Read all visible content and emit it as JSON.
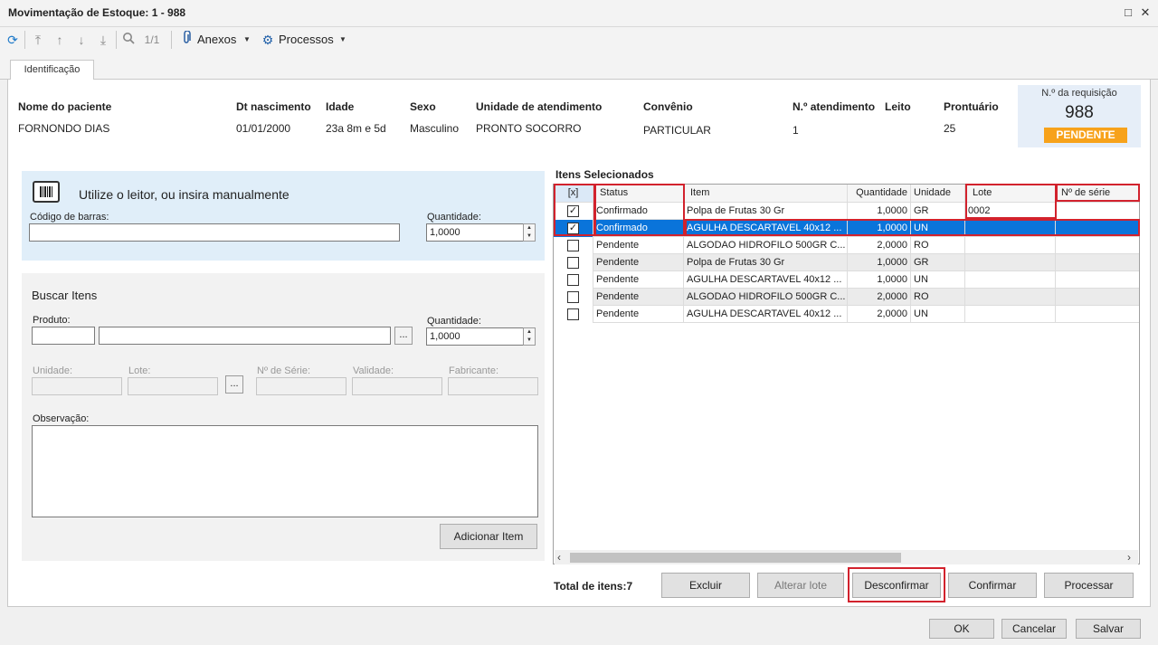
{
  "window": {
    "title": "Movimentação de Estoque: 1 - 988",
    "maximize_icon": "□",
    "close_icon": "✕"
  },
  "toolbar": {
    "page": "1/1",
    "anexos": "Anexos",
    "processos": "Processos"
  },
  "tabs": [
    {
      "label": "Identificação"
    }
  ],
  "patient": {
    "labels": {
      "nome": "Nome do paciente",
      "nasc": "Dt nascimento",
      "idade": "Idade",
      "sexo": "Sexo",
      "unidade": "Unidade de atendimento",
      "convenio": "Convênio",
      "natend": "N.º atendimento",
      "leito": "Leito",
      "prontuario": "Prontuário"
    },
    "values": {
      "nome": "FORNONDO DIAS",
      "nasc": "01/01/2000",
      "idade": "23a 8m  e 5d",
      "sexo": "Masculino",
      "unidade": "PRONTO SOCORRO",
      "convenio": "PARTICULAR",
      "natend": "1",
      "leito": "",
      "prontuario": "25"
    }
  },
  "requisicao": {
    "label": "N.º da requisição",
    "number": "988",
    "status": "PENDENTE",
    "status_color": "#f7a21b"
  },
  "leitor": {
    "title": "Utilize o leitor, ou insira manualmente",
    "barcode_label": "Código de barras:",
    "barcode_value": "",
    "qty_label": "Quantidade:",
    "qty_value": "1,0000"
  },
  "buscar": {
    "title": "Buscar Itens",
    "produto_label": "Produto:",
    "qty_label": "Quantidade:",
    "qty_value": "1,0000",
    "unidade": "Unidade:",
    "lote": "Lote:",
    "serie": "Nº de Série:",
    "validade": "Validade:",
    "fabricante": "Fabricante:",
    "obs": "Observação:",
    "add_button": "Adicionar Item",
    "dots": "..."
  },
  "itens": {
    "title": "Itens Selecionados",
    "columns": [
      "[x]",
      "Status",
      "Item",
      "Quantidade",
      "Unidade",
      "Lote",
      "Nº de série"
    ],
    "rows": [
      {
        "checked": true,
        "status": "Confirmado",
        "item": "Polpa de Frutas 30 Gr",
        "qty": "1,0000",
        "unit": "GR",
        "lote": "0002",
        "serie": ""
      },
      {
        "checked": true,
        "status": "Confirmado",
        "item": "AGULHA DESCARTAVEL 40x12 ...",
        "qty": "1,0000",
        "unit": "UN",
        "lote": "",
        "serie": ""
      },
      {
        "checked": false,
        "status": "Pendente",
        "item": "ALGODAO HIDROFILO 500GR C...",
        "qty": "2,0000",
        "unit": "RO",
        "lote": "",
        "serie": ""
      },
      {
        "checked": false,
        "status": "Pendente",
        "item": "Polpa de Frutas 30 Gr",
        "qty": "1,0000",
        "unit": "GR",
        "lote": "",
        "serie": ""
      },
      {
        "checked": false,
        "status": "Pendente",
        "item": "AGULHA DESCARTAVEL 40x12 ...",
        "qty": "1,0000",
        "unit": "UN",
        "lote": "",
        "serie": ""
      },
      {
        "checked": false,
        "status": "Pendente",
        "item": "ALGODAO HIDROFILO 500GR C...",
        "qty": "2,0000",
        "unit": "RO",
        "lote": "",
        "serie": ""
      },
      {
        "checked": false,
        "status": "Pendente",
        "item": "AGULHA DESCARTAVEL 40x12 ...",
        "qty": "2,0000",
        "unit": "UN",
        "lote": "",
        "serie": ""
      }
    ],
    "selected_color": "#0a74da",
    "total": "Total de itens:7"
  },
  "actions": {
    "excluir": "Excluir",
    "alterar_lote": "Alterar lote",
    "desconfirmar": "Desconfirmar",
    "confirmar": "Confirmar",
    "processar": "Processar"
  },
  "footer": {
    "ok": "OK",
    "cancelar": "Cancelar",
    "salvar": "Salvar"
  }
}
